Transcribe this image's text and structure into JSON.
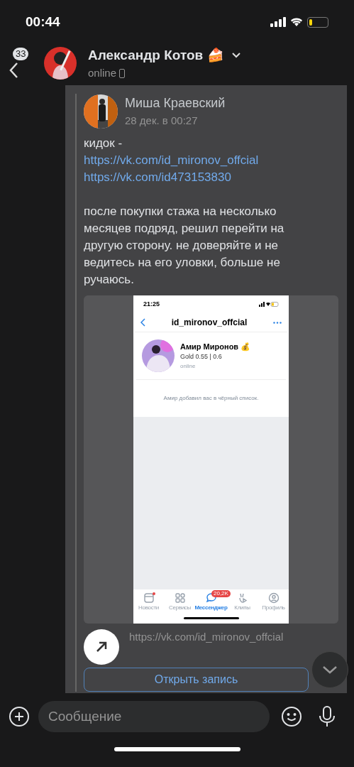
{
  "status_bar": {
    "time": "00:44"
  },
  "header": {
    "back_badge": "33",
    "name": "Александр Котов 🍰",
    "status": "online"
  },
  "post": {
    "author": "Миша Краевский",
    "date": "28 дек. в 00:27",
    "lines": [
      {
        "kind": "text",
        "text": "кидок -"
      },
      {
        "kind": "link",
        "text": "https://vk.com/id_mironov_offcial"
      },
      {
        "kind": "link",
        "text": "https://vk.com/id473153830"
      },
      {
        "kind": "gap"
      },
      {
        "kind": "text",
        "text": "после покупки стажа на несколько месяцев подряд, решил перейти на другую сторону. не доверяйте и не ведитесь на его уловки, больше не ручаюсь."
      }
    ],
    "screenshot": {
      "time": "21:25",
      "title": "id_mironov_offcial",
      "name": "Амир Миронов 💰",
      "subtitle": "Gold 0.55 | 0.6",
      "status": "online",
      "notice": "Амир добавил вас в чёрный список.",
      "tabs": [
        {
          "label": "Новости",
          "selected": false,
          "dot": true
        },
        {
          "label": "Сервисы",
          "selected": false,
          "dot": false
        },
        {
          "label": "Мессенджер",
          "selected": true,
          "dot": false,
          "badge": "20,2K"
        },
        {
          "label": "Клипы",
          "selected": false,
          "dot": false
        },
        {
          "label": "Профиль",
          "selected": false,
          "dot": false
        }
      ]
    },
    "link": "https://vk.com/id_mironov_offcial",
    "open_button": "Открыть запись"
  },
  "composer": {
    "placeholder": "Сообщение"
  }
}
